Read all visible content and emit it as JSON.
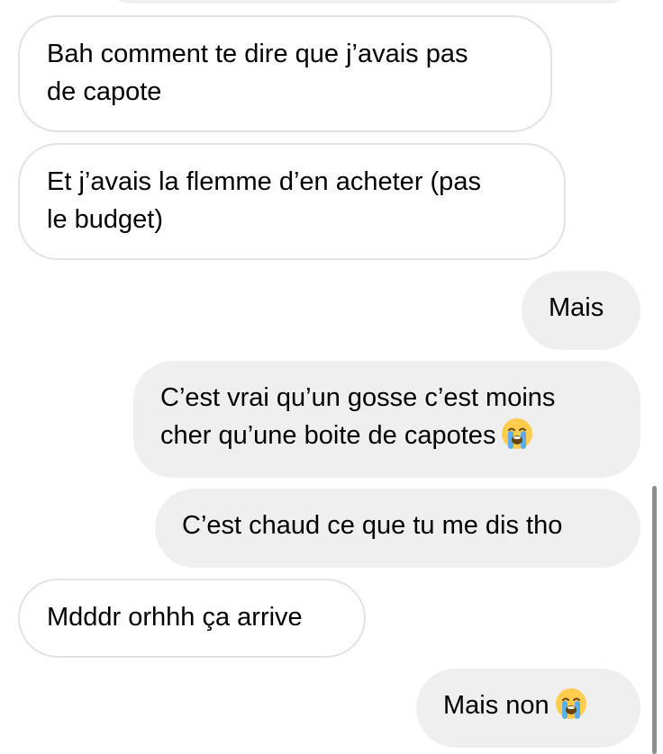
{
  "messages": [
    {
      "sender": "them",
      "text": "Bah comment te dire que j’avais pas de capote",
      "lines": [
        "Bah comment te dire que j’avais pas",
        "de capote"
      ]
    },
    {
      "sender": "them",
      "text": "Et j’avais la flemme d’en acheter (pas le budget)",
      "lines": [
        "Et j’avais la flemme d’en acheter (pas",
        "le budget)"
      ]
    },
    {
      "sender": "me",
      "text": "Mais",
      "lines": [
        "Mais"
      ]
    },
    {
      "sender": "me",
      "text": "C’est vrai qu’un gosse c’est moins cher qu’une boite de capotes 😭",
      "lines": [
        "C’est vrai qu’un gosse c’est moins",
        "cher qu’une boite de capotes"
      ],
      "emoji": "loudly-crying-face"
    },
    {
      "sender": "me",
      "text": "C’est chaud ce que tu me dis tho",
      "lines": [
        "C’est chaud ce que tu me dis tho"
      ]
    },
    {
      "sender": "them",
      "text": "Mdddr orhhh ça arrive",
      "lines": [
        "Mdddr orhhh ça arrive"
      ]
    },
    {
      "sender": "me",
      "text": "Mais non 😭",
      "lines": [
        "Mais non"
      ],
      "emoji": "loudly-crying-face"
    }
  ],
  "colors": {
    "incoming_bg": "#ffffff",
    "incoming_border": "#e3e3e3",
    "outgoing_bg": "#efefef",
    "text": "#000000",
    "scrollbar": "#8e8e8e"
  }
}
